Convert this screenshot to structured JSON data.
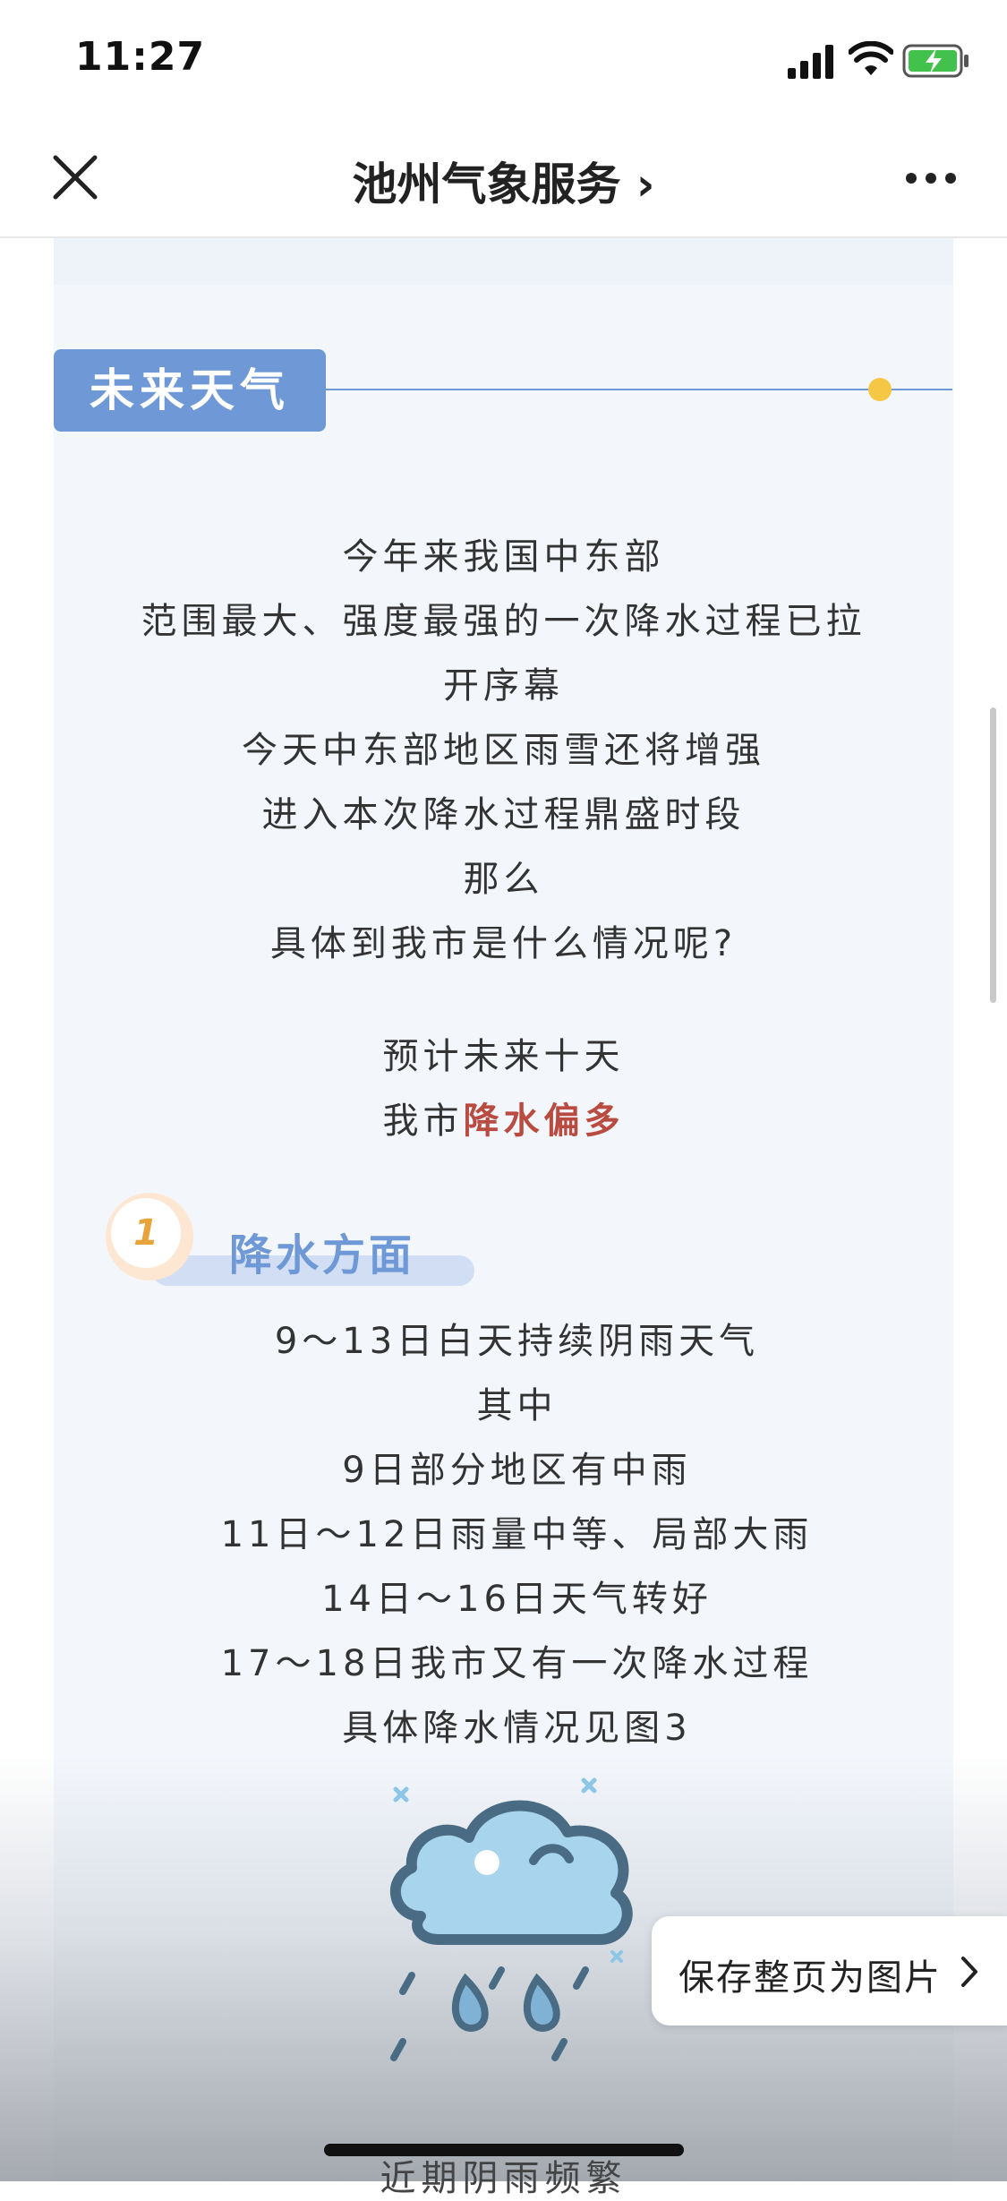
{
  "status_bar": {
    "time": "11:27"
  },
  "nav": {
    "title": "池州气象服务 ›"
  },
  "section": {
    "title": "未来天气"
  },
  "intro_lines": [
    "今年来我国中东部",
    "范围最大、强度最强的一次降水过程已拉",
    "开序幕",
    "今天中东部地区雨雪还将增强",
    "进入本次降水过程鼎盛时段",
    "那么",
    "具体到我市是什么情况呢?"
  ],
  "forecast": {
    "line1": "预计未来十天",
    "line2_prefix": "我市",
    "line2_highlight": "降水偏多"
  },
  "subsection": {
    "number": "1",
    "title": "降水方面"
  },
  "rain_lines": [
    "9～13日白天持续阴雨天气",
    "其中",
    "9日部分地区有中雨",
    "11日～12日雨量中等、局部大雨",
    "14日～16日天气转好",
    "17～18日我市又有一次降水过程",
    "具体降水情况见图3"
  ],
  "save_button": {
    "label": "保存整页为图片"
  },
  "bottom_partial_text": "近期阴雨频繁",
  "colors": {
    "accent_blue": "#6f98d6",
    "highlight_red": "#b94b40",
    "dot_yellow": "#f6c744",
    "number_orange": "#e8a43a"
  }
}
